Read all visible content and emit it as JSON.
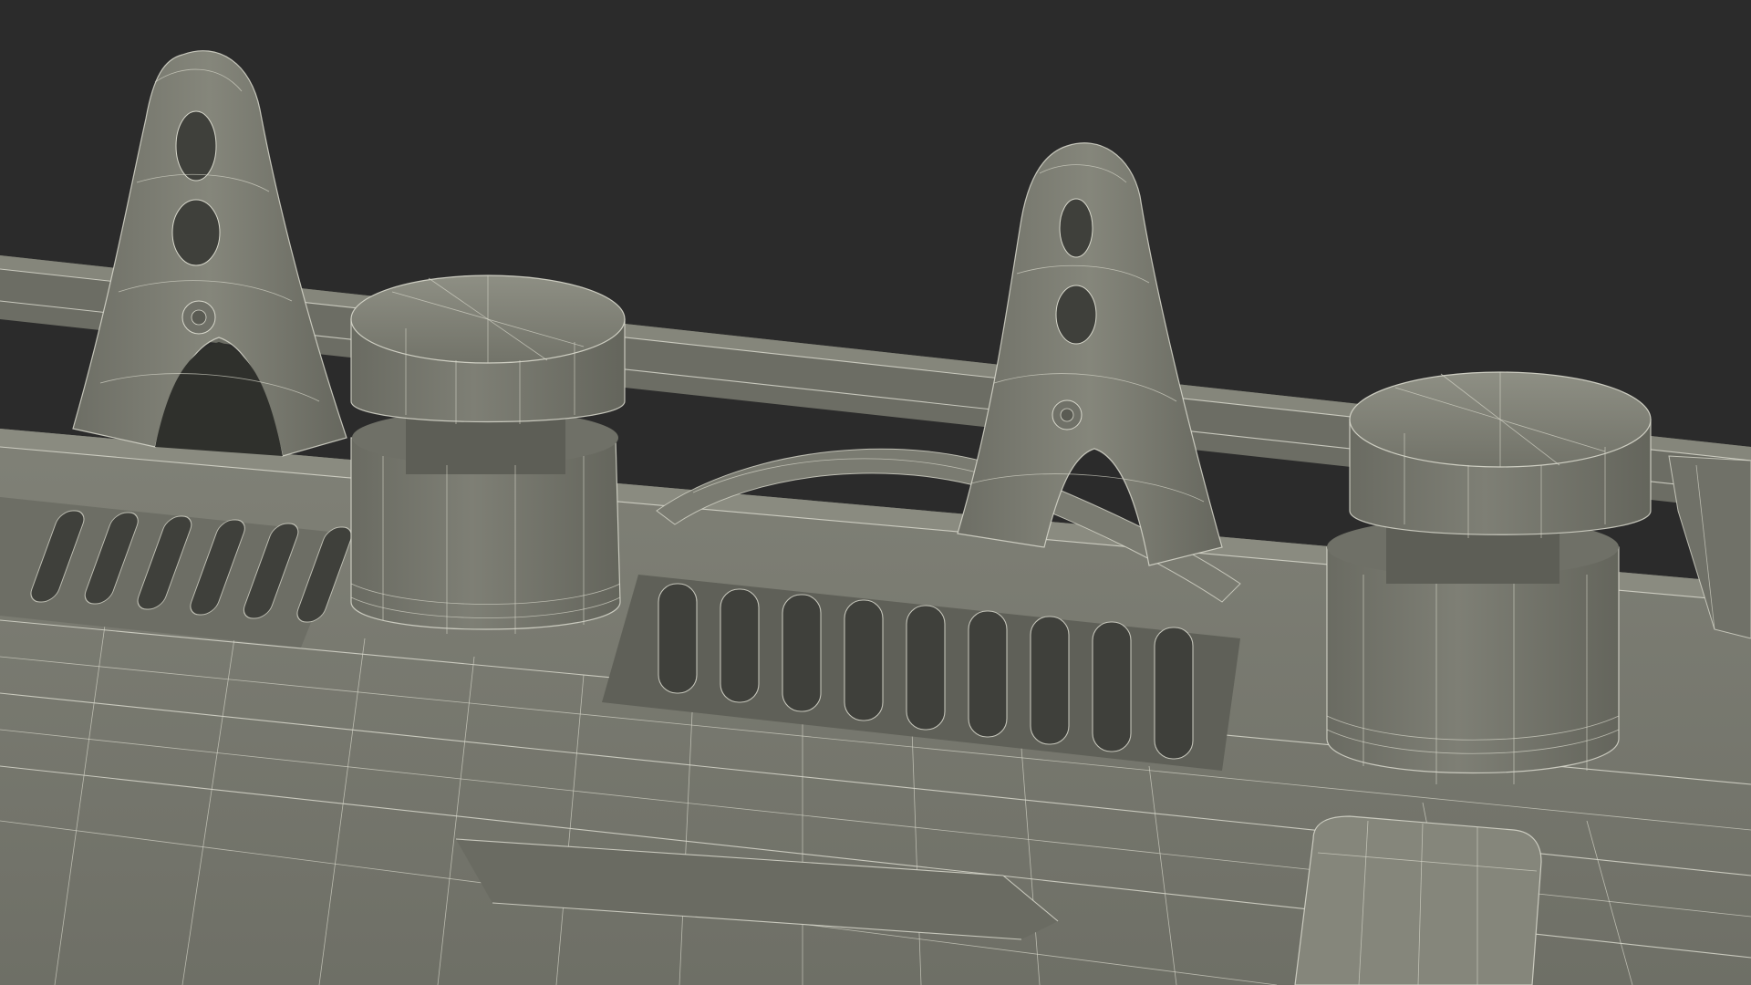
{
  "scene": {
    "subject": "wireframe-render",
    "colors": {
      "background": "#2b2b2b",
      "surface": "#7a7b71",
      "surface_light": "#8a8b80",
      "surface_dark": "#5d5e56",
      "shadow": "#3f403b",
      "slot": "#4a4b45",
      "wire": "#d8d8cc"
    }
  }
}
